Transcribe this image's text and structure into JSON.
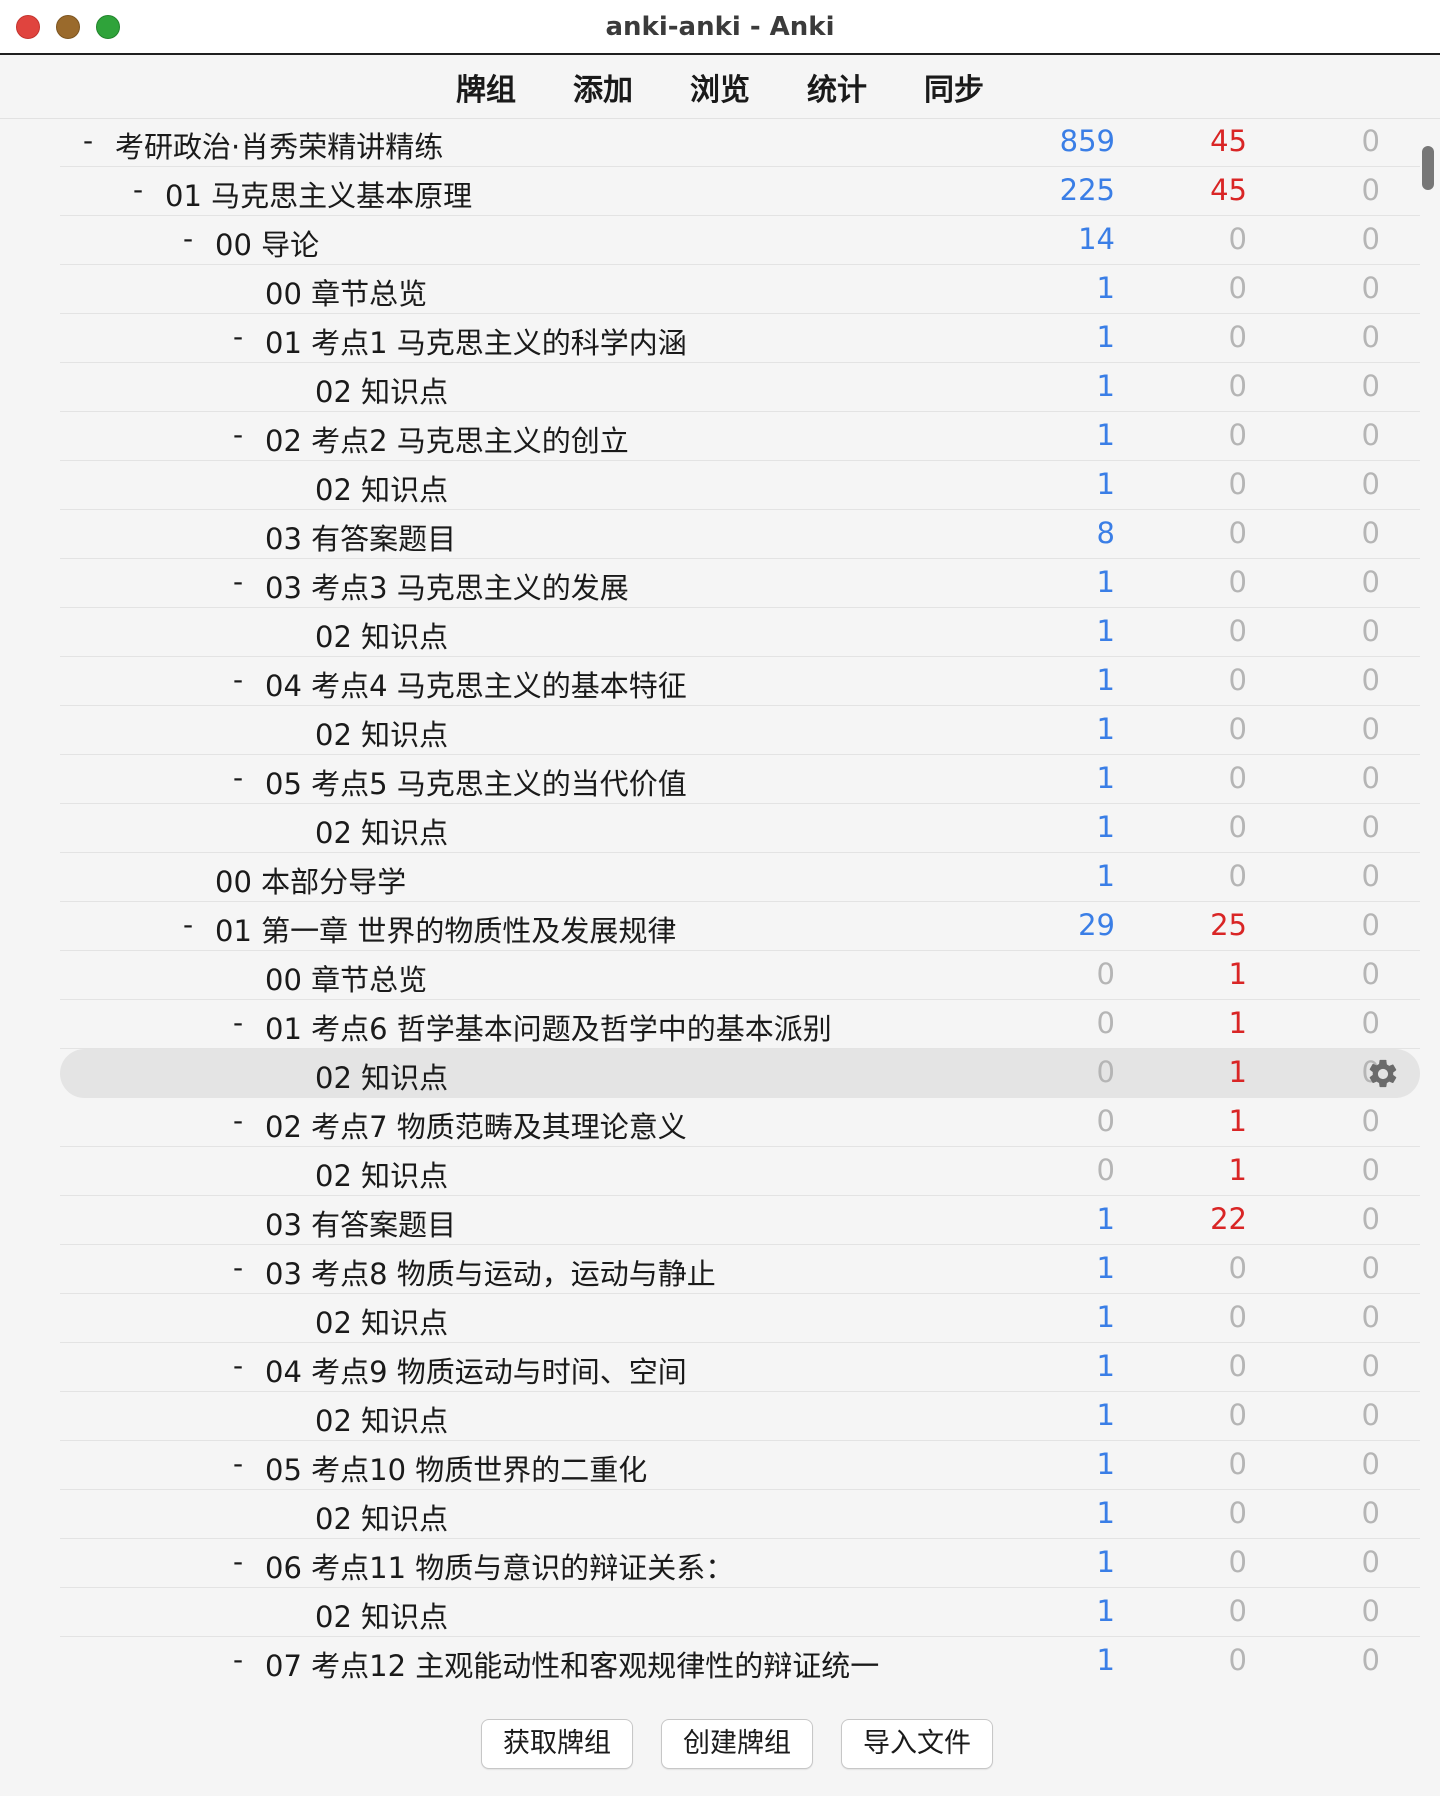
{
  "window": {
    "title": "anki-anki - Anki"
  },
  "nav": {
    "decks": "牌组",
    "add": "添加",
    "browse": "浏览",
    "stats": "统计",
    "sync": "同步"
  },
  "colors": {
    "new": "#3a7ee6",
    "learn": "#d92525",
    "zero": "#b5b5b5"
  },
  "decks": [
    {
      "name": "考研政治·肖秀荣精讲精练",
      "depth": 0,
      "collapse": "-",
      "new": "859",
      "learn": "45",
      "due": "0"
    },
    {
      "name": "01 马克思主义基本原理",
      "depth": 1,
      "collapse": "-",
      "new": "225",
      "learn": "45",
      "due": "0"
    },
    {
      "name": "00 导论",
      "depth": 2,
      "collapse": "-",
      "new": "14",
      "learn": "0",
      "due": "0"
    },
    {
      "name": "00 章节总览",
      "depth": 3,
      "collapse": "",
      "new": "1",
      "learn": "0",
      "due": "0"
    },
    {
      "name": "01 考点1 马克思主义的科学内涵",
      "depth": 3,
      "collapse": "-",
      "new": "1",
      "learn": "0",
      "due": "0"
    },
    {
      "name": "02 知识点",
      "depth": 4,
      "collapse": "",
      "new": "1",
      "learn": "0",
      "due": "0"
    },
    {
      "name": "02 考点2 马克思主义的创立",
      "depth": 3,
      "collapse": "-",
      "new": "1",
      "learn": "0",
      "due": "0"
    },
    {
      "name": "02 知识点",
      "depth": 4,
      "collapse": "",
      "new": "1",
      "learn": "0",
      "due": "0"
    },
    {
      "name": "03 有答案题目",
      "depth": 3,
      "collapse": "",
      "new": "8",
      "learn": "0",
      "due": "0"
    },
    {
      "name": "03 考点3 马克思主义的发展",
      "depth": 3,
      "collapse": "-",
      "new": "1",
      "learn": "0",
      "due": "0"
    },
    {
      "name": "02 知识点",
      "depth": 4,
      "collapse": "",
      "new": "1",
      "learn": "0",
      "due": "0"
    },
    {
      "name": "04 考点4 马克思主义的基本特征",
      "depth": 3,
      "collapse": "-",
      "new": "1",
      "learn": "0",
      "due": "0"
    },
    {
      "name": "02 知识点",
      "depth": 4,
      "collapse": "",
      "new": "1",
      "learn": "0",
      "due": "0"
    },
    {
      "name": "05 考点5 马克思主义的当代价值",
      "depth": 3,
      "collapse": "-",
      "new": "1",
      "learn": "0",
      "due": "0"
    },
    {
      "name": "02 知识点",
      "depth": 4,
      "collapse": "",
      "new": "1",
      "learn": "0",
      "due": "0"
    },
    {
      "name": "00 本部分导学",
      "depth": 2,
      "collapse": "",
      "new": "1",
      "learn": "0",
      "due": "0"
    },
    {
      "name": "01 第一章 世界的物质性及发展规律",
      "depth": 2,
      "collapse": "-",
      "new": "29",
      "learn": "25",
      "due": "0"
    },
    {
      "name": "00 章节总览",
      "depth": 3,
      "collapse": "",
      "new": "0",
      "learn": "1",
      "due": "0"
    },
    {
      "name": "01 考点6 哲学基本问题及哲学中的基本派别",
      "depth": 3,
      "collapse": "-",
      "new": "0",
      "learn": "1",
      "due": "0"
    },
    {
      "name": "02 知识点",
      "depth": 4,
      "collapse": "",
      "new": "0",
      "learn": "1",
      "due": "0",
      "current": true
    },
    {
      "name": "02 考点7 物质范畴及其理论意义",
      "depth": 3,
      "collapse": "-",
      "new": "0",
      "learn": "1",
      "due": "0"
    },
    {
      "name": "02 知识点",
      "depth": 4,
      "collapse": "",
      "new": "0",
      "learn": "1",
      "due": "0"
    },
    {
      "name": "03 有答案题目",
      "depth": 3,
      "collapse": "",
      "new": "1",
      "learn": "22",
      "due": "0"
    },
    {
      "name": "03 考点8 物质与运动，运动与静止",
      "depth": 3,
      "collapse": "-",
      "new": "1",
      "learn": "0",
      "due": "0"
    },
    {
      "name": "02 知识点",
      "depth": 4,
      "collapse": "",
      "new": "1",
      "learn": "0",
      "due": "0"
    },
    {
      "name": "04 考点9 物质运动与时间、空间",
      "depth": 3,
      "collapse": "-",
      "new": "1",
      "learn": "0",
      "due": "0"
    },
    {
      "name": "02 知识点",
      "depth": 4,
      "collapse": "",
      "new": "1",
      "learn": "0",
      "due": "0"
    },
    {
      "name": "05 考点10 物质世界的二重化",
      "depth": 3,
      "collapse": "-",
      "new": "1",
      "learn": "0",
      "due": "0"
    },
    {
      "name": "02 知识点",
      "depth": 4,
      "collapse": "",
      "new": "1",
      "learn": "0",
      "due": "0"
    },
    {
      "name": "06 考点11 物质与意识的辩证关系：",
      "depth": 3,
      "collapse": "-",
      "new": "1",
      "learn": "0",
      "due": "0"
    },
    {
      "name": "02 知识点",
      "depth": 4,
      "collapse": "",
      "new": "1",
      "learn": "0",
      "due": "0"
    },
    {
      "name": "07 考点12 主观能动性和客观规律性的辩证统一",
      "depth": 3,
      "collapse": "-",
      "new": "1",
      "learn": "0",
      "due": "0"
    }
  ],
  "bottom": {
    "get_shared": "获取牌组",
    "create_deck": "创建牌组",
    "import_file": "导入文件"
  }
}
